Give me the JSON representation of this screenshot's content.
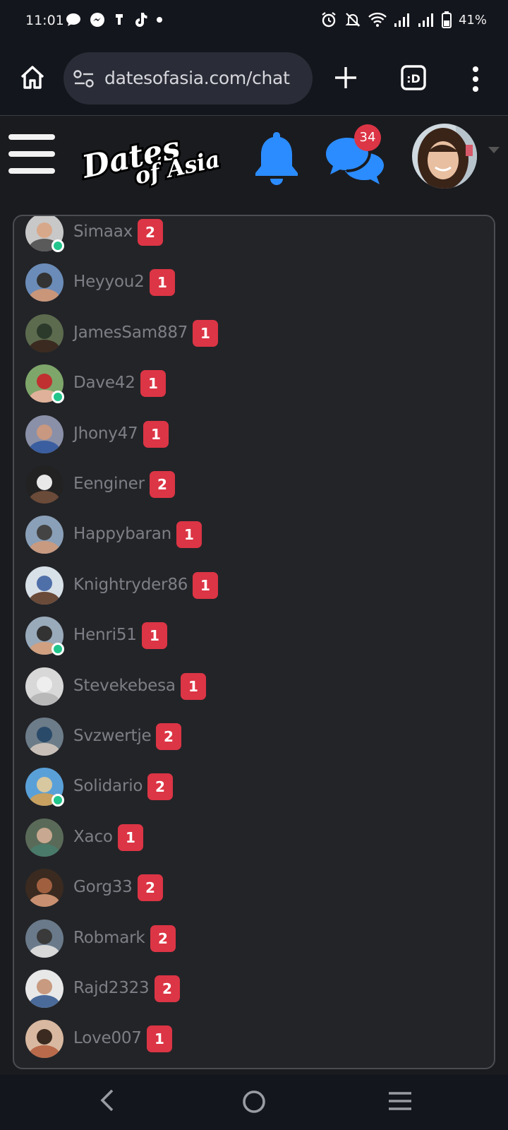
{
  "status_bar": {
    "time": "11:01",
    "battery": "41%"
  },
  "browser": {
    "url": "datesofasia.com/chat",
    "tabs_label": ":D"
  },
  "header": {
    "logo_line1": "Dates",
    "logo_line2": "of Asia",
    "messages_count": "34"
  },
  "chats": [
    {
      "name": "Simaax",
      "count": "2",
      "online": true
    },
    {
      "name": "Heyyou2",
      "count": "1",
      "online": false
    },
    {
      "name": "JamesSam887",
      "count": "1",
      "online": false
    },
    {
      "name": "Dave42",
      "count": "1",
      "online": true
    },
    {
      "name": "Jhony47",
      "count": "1",
      "online": false
    },
    {
      "name": "Eenginer",
      "count": "2",
      "online": false
    },
    {
      "name": "Happybaran",
      "count": "1",
      "online": false
    },
    {
      "name": "Knightryder86",
      "count": "1",
      "online": false
    },
    {
      "name": "Henri51",
      "count": "1",
      "online": true
    },
    {
      "name": "Stevekebesa",
      "count": "1",
      "online": false
    },
    {
      "name": "Svzwertje",
      "count": "2",
      "online": false
    },
    {
      "name": "Solidario",
      "count": "2",
      "online": true
    },
    {
      "name": "Xaco",
      "count": "1",
      "online": false
    },
    {
      "name": "Gorg33",
      "count": "2",
      "online": false
    },
    {
      "name": "Robmark",
      "count": "2",
      "online": false
    },
    {
      "name": "Rajd2323",
      "count": "2",
      "online": false
    },
    {
      "name": "Love007",
      "count": "1",
      "online": false
    }
  ],
  "colors": {
    "accent": "#2b8cff",
    "badge": "#dc3545",
    "online": "#22c58b"
  }
}
